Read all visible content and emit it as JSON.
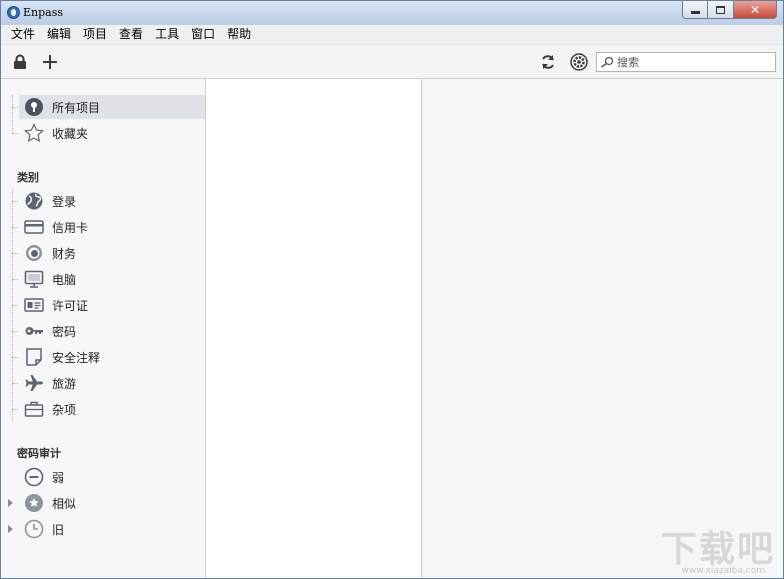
{
  "window": {
    "title": "Enpass",
    "controls": {
      "minimize": "minimize",
      "maximize": "maximize",
      "close": "close"
    }
  },
  "menu": [
    "文件",
    "编辑",
    "项目",
    "查看",
    "工具",
    "窗口",
    "帮助"
  ],
  "toolbar": {
    "lock_icon": "lock-icon",
    "add_icon": "plus-icon",
    "sync_icon": "sync-icon",
    "settings_icon": "gear-icon",
    "search_placeholder": "搜索"
  },
  "sidebar": {
    "top_items": [
      {
        "label": "所有项目",
        "icon": "key-circle-icon",
        "selected": true
      },
      {
        "label": "收藏夹",
        "icon": "star-icon",
        "selected": false
      }
    ],
    "categories_title": "类别",
    "categories": [
      {
        "label": "登录",
        "icon": "globe-icon"
      },
      {
        "label": "信用卡",
        "icon": "credit-card-icon"
      },
      {
        "label": "财务",
        "icon": "coin-icon"
      },
      {
        "label": "电脑",
        "icon": "monitor-icon"
      },
      {
        "label": "许可证",
        "icon": "license-icon"
      },
      {
        "label": "密码",
        "icon": "key-icon"
      },
      {
        "label": "安全注释",
        "icon": "note-icon"
      },
      {
        "label": "旅游",
        "icon": "airplane-icon"
      },
      {
        "label": "杂项",
        "icon": "briefcase-icon"
      }
    ],
    "audit_title": "密码审计",
    "audit": [
      {
        "label": "弱",
        "icon": "minus-circle-icon",
        "expandable": false
      },
      {
        "label": "相似",
        "icon": "star-badge-icon",
        "expandable": true
      },
      {
        "label": "旧",
        "icon": "clock-icon",
        "expandable": true
      }
    ]
  },
  "watermark": {
    "main": "下载吧",
    "sub": "www.xiazaiba.com"
  }
}
